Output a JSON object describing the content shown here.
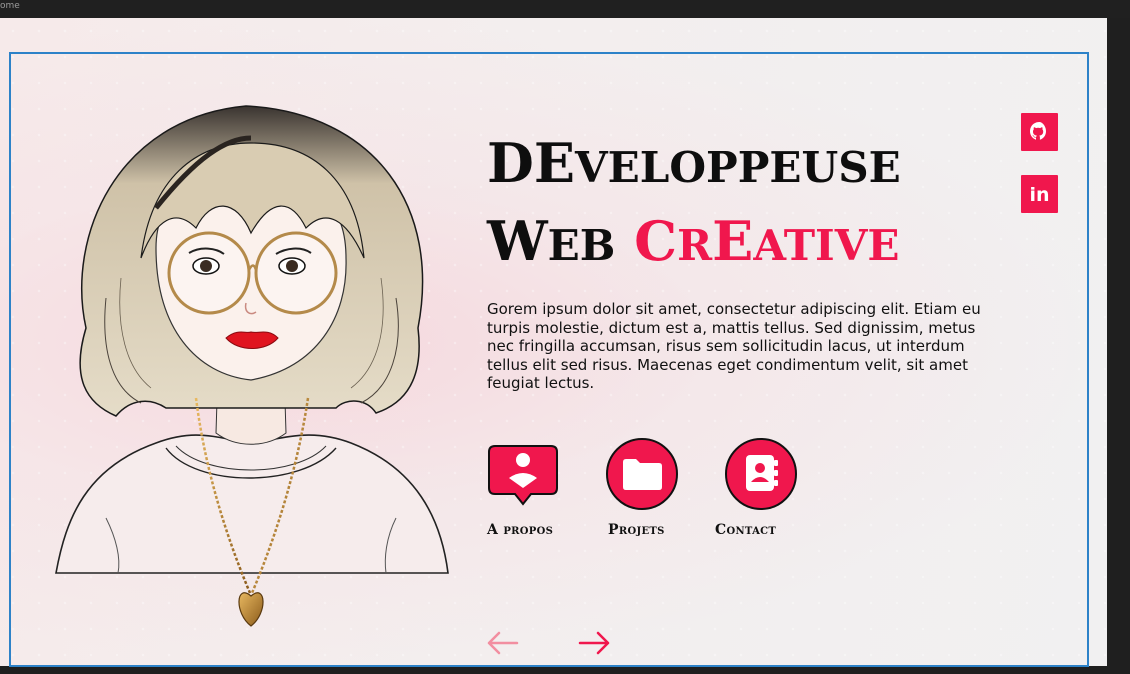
{
  "window": {
    "title": "ome"
  },
  "hero": {
    "title_line1_cap": "D",
    "title_line1_e": "E",
    "title_line1_rest": "VELOPPEUSE",
    "title_line2_cap": "W",
    "title_line2_rest": "EB",
    "title_line2_accent_cap": "C",
    "title_line2_accent_r": "R",
    "title_line2_accent_e": "E",
    "title_line2_accent_rest": "ATIVE",
    "description": "Gorem ipsum dolor sit amet, consectetur adipiscing elit. Etiam eu turpis molestie, dictum est a, mattis tellus. Sed dignissim, metus nec fringilla accumsan, risus sem sollicitudin lacus, ut interdum tellus elit sed risus. Maecenas eget condimentum velit, sit amet feugiat lectus."
  },
  "actions": [
    {
      "label": "A propos",
      "icon": "user-chat-icon"
    },
    {
      "label": "Projets",
      "icon": "folder-icon"
    },
    {
      "label": "Contact",
      "icon": "address-book-icon"
    }
  ],
  "social": [
    {
      "name": "github",
      "icon": "github-icon"
    },
    {
      "name": "linkedin",
      "icon": "linkedin-icon",
      "text": "in"
    }
  ],
  "navigation": {
    "prev_icon": "arrow-left-icon",
    "next_icon": "arrow-right-icon"
  },
  "colors": {
    "accent": "#f0174d",
    "frame": "#2d82c8",
    "text": "#0e0e0e",
    "prev_arrow": "#f28ea0"
  }
}
